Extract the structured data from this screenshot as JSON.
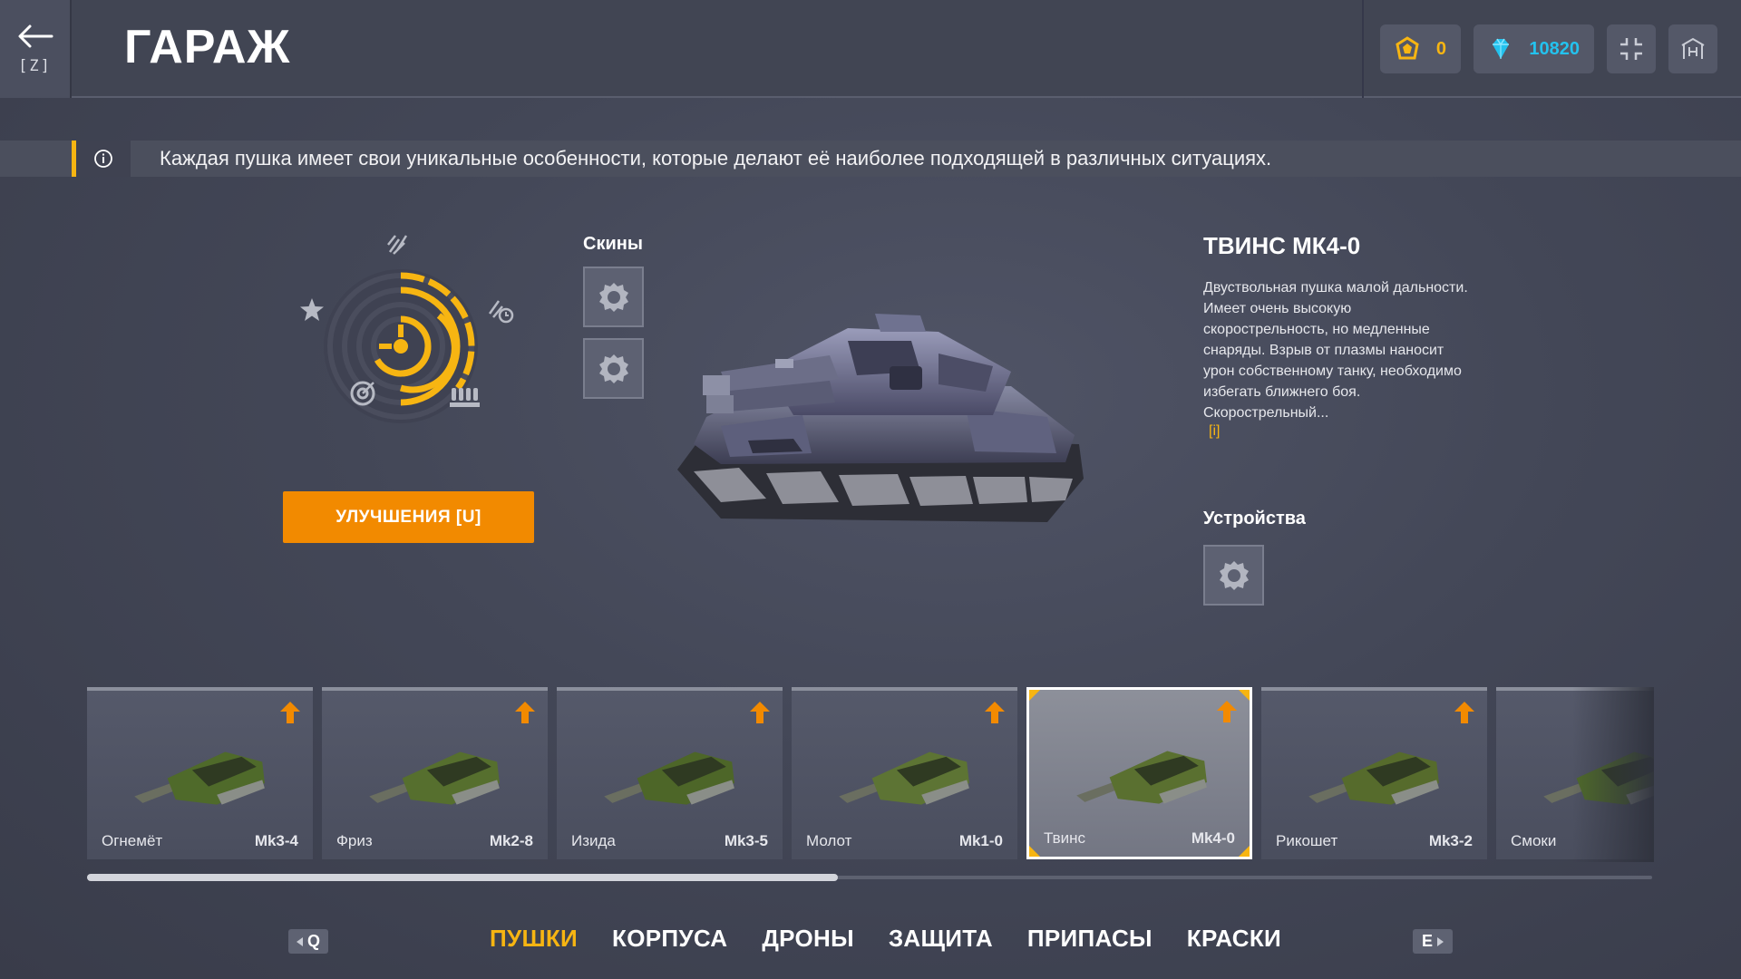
{
  "header": {
    "back_key": "[Z]",
    "title": "ГАРАЖ",
    "crystals": "0",
    "diamonds": "10820",
    "fullscreen_icon": "fullscreen-icon",
    "hangar_icon": "hangar-icon"
  },
  "info": {
    "icon": "info-icon",
    "text": "Каждая пушка имеет свои уникальные особенности, которые делают её наиболее подходящей в различных ситуациях."
  },
  "upgrades": {
    "button_label": "УЛУЧШЕНИЯ [U]"
  },
  "skins": {
    "label": "Скины",
    "slots": [
      "skin-slot-1",
      "skin-slot-2"
    ]
  },
  "item": {
    "title": "ТВИНС МК4-0",
    "description": "Двуствольная пушка малой дальности. Имеет очень высокую скорострельность, но медленные снаряды. Взрыв от плазмы наносит урон собственному танку, необходимо избегать ближнего боя. Скорострельный...",
    "more_link": "[i]"
  },
  "devices": {
    "label": "Устройства"
  },
  "turrets": [
    {
      "name": "Огнемёт",
      "mk": "Mk3-4",
      "upgradable": true,
      "selected": false
    },
    {
      "name": "Фриз",
      "mk": "Mk2-8",
      "upgradable": true,
      "selected": false
    },
    {
      "name": "Изида",
      "mk": "Mk3-5",
      "upgradable": true,
      "selected": false
    },
    {
      "name": "Молот",
      "mk": "Mk1-0",
      "upgradable": true,
      "selected": false
    },
    {
      "name": "Твинс",
      "mk": "Mk4-0",
      "upgradable": true,
      "selected": true
    },
    {
      "name": "Рикошет",
      "mk": "Mk3-2",
      "upgradable": true,
      "selected": false
    },
    {
      "name": "Смоки",
      "mk": "",
      "upgradable": false,
      "selected": false
    }
  ],
  "scroll": {
    "position_fraction": 0.48
  },
  "nav": {
    "prev_key": "Q",
    "next_key": "E",
    "tabs": [
      {
        "label": "ПУШКИ",
        "active": true
      },
      {
        "label": "КОРПУСА",
        "active": false
      },
      {
        "label": "ДРОНЫ",
        "active": false
      },
      {
        "label": "ЗАЩИТА",
        "active": false
      },
      {
        "label": "ПРИПАСЫ",
        "active": false
      },
      {
        "label": "КРАСКИ",
        "active": false
      }
    ]
  },
  "colors": {
    "accent": "#f7b512",
    "upgrade_button": "#f28a00",
    "diamonds": "#23c2ee",
    "upgrade_arrow": "#f28a00"
  }
}
